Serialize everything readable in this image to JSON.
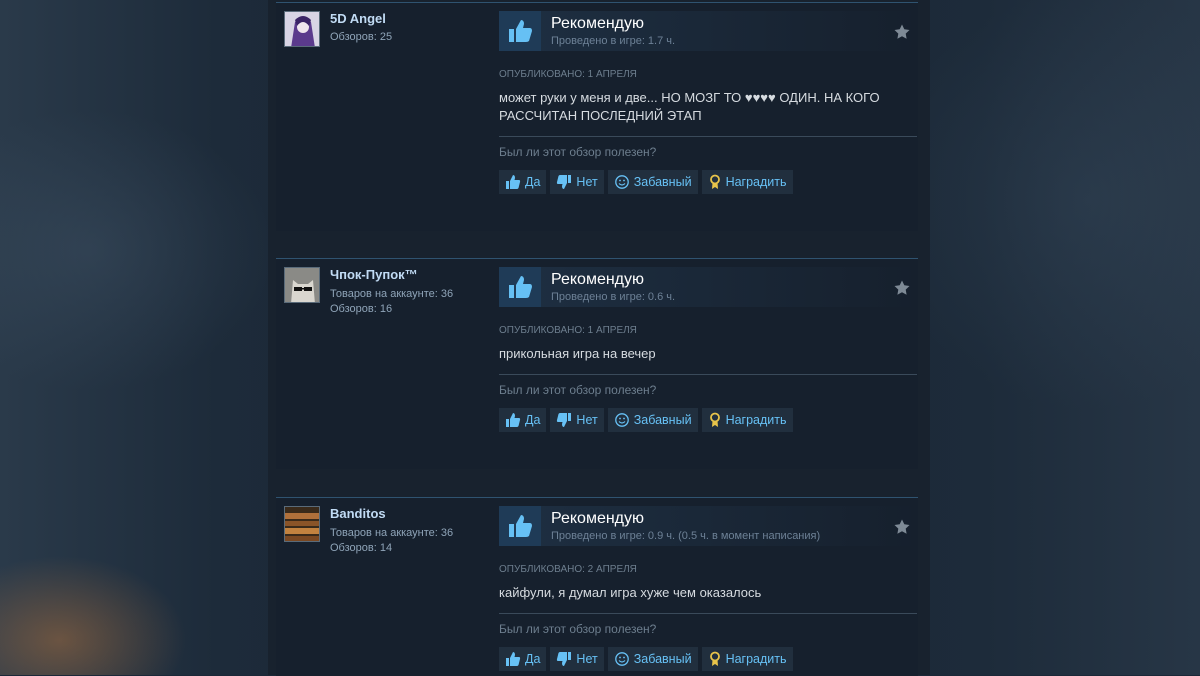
{
  "reviews": [
    {
      "author": "5D Angel",
      "lines": [
        "Обзоров: 25"
      ],
      "avatar_icon": "anime-avatar",
      "verdict": "Рекомендую",
      "playtime": "Проведено в игре: 1.7 ч.",
      "posted": "Опубликовано: 1 апреля",
      "text": "может руки у меня и две... НО МОЗГ ТО ♥♥♥♥ ОДИН. НА КОГО РАССЧИТАН ПОСЛЕДНИЙ ЭТАП",
      "helpful_question": "Был ли этот обзор полезен?",
      "buttons": {
        "yes": "Да",
        "no": "Нет",
        "funny": "Забавный",
        "award": "Наградить"
      }
    },
    {
      "author": "Чпок-Пупок™",
      "lines": [
        "Товаров на аккаунте: 36",
        "Обзоров: 16"
      ],
      "avatar_icon": "cat-sunglasses-avatar",
      "verdict": "Рекомендую",
      "playtime": "Проведено в игре: 0.6 ч.",
      "posted": "Опубликовано: 1 апреля",
      "text": "прикольная игра на вечер",
      "helpful_question": "Был ли этот обзор полезен?",
      "buttons": {
        "yes": "Да",
        "no": "Нет",
        "funny": "Забавный",
        "award": "Наградить"
      }
    },
    {
      "author": "Banditos",
      "lines": [
        "Товаров на аккаунте: 36",
        "Обзоров: 14"
      ],
      "avatar_icon": "temple-avatar",
      "verdict": "Рекомендую",
      "playtime": "Проведено в игре: 0.9 ч. (0.5 ч. в момент написания)",
      "posted": "Опубликовано: 2 апреля",
      "text": "кайфули, я думал игра хуже чем оказалось",
      "helpful_question": "Был ли этот обзор полезен?",
      "buttons": {
        "yes": "Да",
        "no": "Нет",
        "funny": "Забавный",
        "award": "Наградить"
      }
    }
  ],
  "colors": {
    "accent": "#67c1f5",
    "page_bg": "#1b2838",
    "card_bg": "#16202d"
  }
}
